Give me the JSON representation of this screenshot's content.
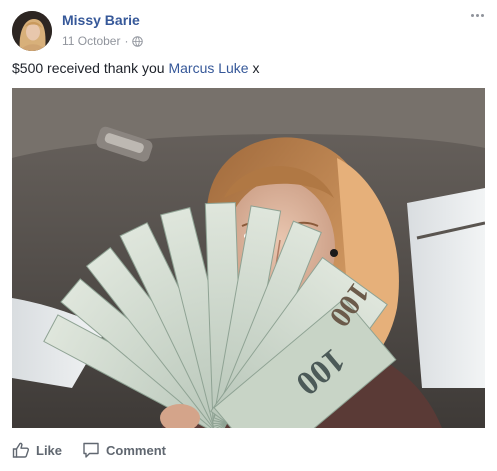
{
  "post": {
    "author": "Missy Barie",
    "date": "11 October",
    "separator": "·",
    "text_before": "$500 received thank you ",
    "mention": "Marcus Luke",
    "text_after": " x"
  },
  "actions": {
    "like_label": "Like",
    "comment_label": "Comment"
  },
  "colors": {
    "link": "#365899",
    "secondary_text": "#90949c",
    "action_text": "#606770"
  },
  "icons": {
    "privacy": "globe-icon",
    "like": "thumbs-up-icon",
    "comment": "speech-bubble-icon",
    "options": "ellipsis-icon"
  }
}
